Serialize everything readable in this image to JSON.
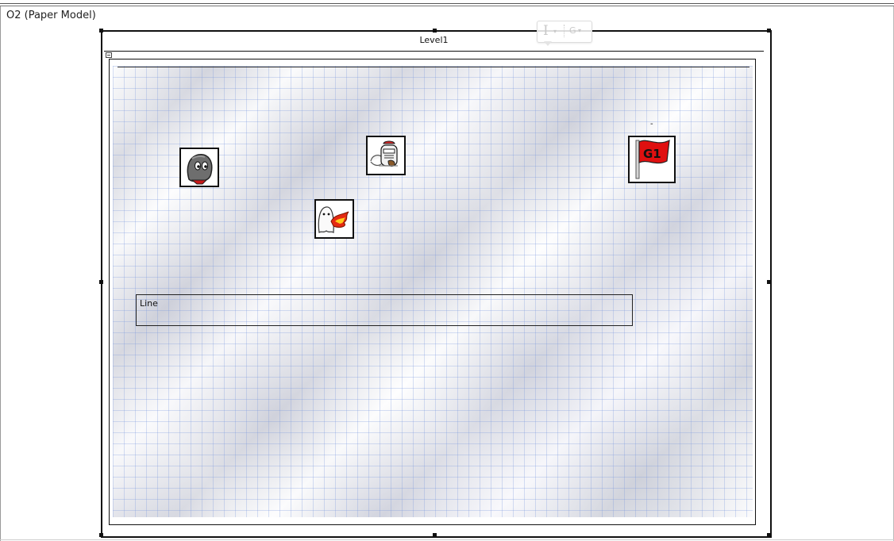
{
  "window": {
    "model_title": "O2 (Paper Model)"
  },
  "level": {
    "label": "Level1"
  },
  "toolbar": {
    "text_icon": "text-format-icon",
    "text_glyph": "I",
    "graphics_icon": "graphics-icon",
    "graphics_glyph": "G",
    "dropdown_glyph": "▾"
  },
  "canvas": {
    "background": "crumpled-graph-paper",
    "marker_text": "-",
    "sprites": [
      {
        "name": "rock-creature-sprite",
        "icon": "rock-creature-icon"
      },
      {
        "name": "chef-creature-sprite",
        "icon": "chef-creature-icon"
      },
      {
        "name": "fire-ghost-sprite",
        "icon": "fire-ghost-icon"
      },
      {
        "name": "goal-flag-sprite",
        "icon": "goal-flag-icon",
        "label": "G1"
      }
    ],
    "line_object": {
      "label": "Line"
    }
  },
  "colors": {
    "frame": "#111111",
    "flag_red": "#e01010",
    "grid_blue": "#7896dc",
    "paper": "#eef0f6"
  }
}
